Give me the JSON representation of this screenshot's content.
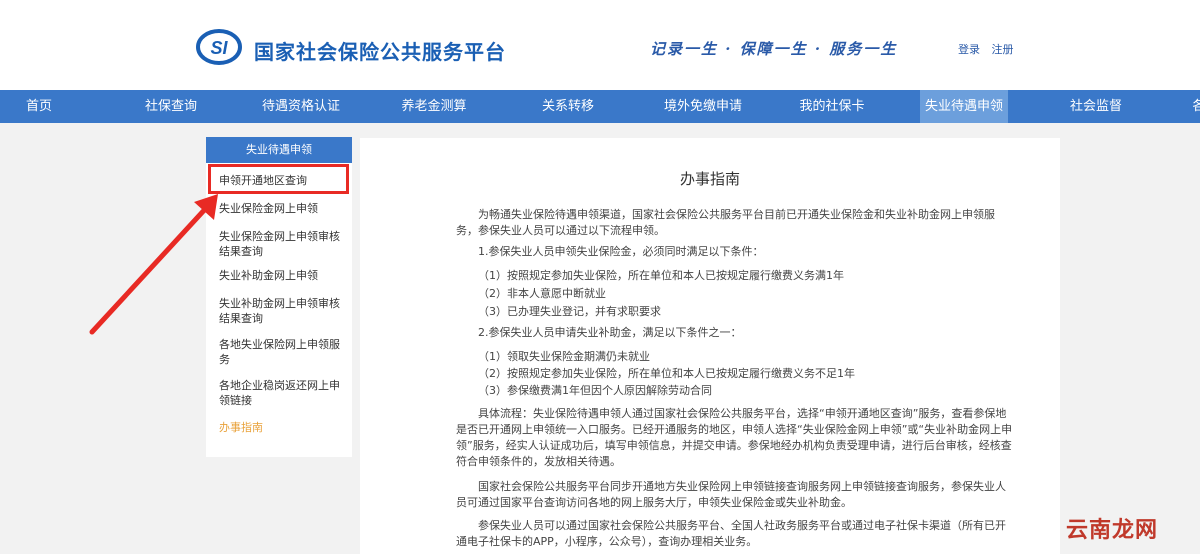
{
  "header": {
    "logo_text": "SI",
    "site_title": "国家社会保险公共服务平台",
    "slogan": "记录一生 · 保障一生 · 服务一生",
    "login_label": "登录",
    "register_label": "注册"
  },
  "nav": {
    "items": [
      {
        "label": "首页"
      },
      {
        "label": "社保查询"
      },
      {
        "label": "待遇资格认证"
      },
      {
        "label": "养老金测算"
      },
      {
        "label": "关系转移"
      },
      {
        "label": "境外免缴申请"
      },
      {
        "label": "我的社保卡"
      },
      {
        "label": "失业待遇申领"
      },
      {
        "label": "社会监督"
      },
      {
        "label": "各"
      }
    ],
    "active_index": 7,
    "colors": {
      "bar": "#3a78c9",
      "active": "#6c9fdc"
    }
  },
  "sidebar": {
    "heading": "失业待遇申领",
    "items": [
      {
        "label": "申领开通地区查询"
      },
      {
        "label": "失业保险金网上申领"
      },
      {
        "label": "失业保险金网上申领审核结果查询"
      },
      {
        "label": "失业补助金网上申领"
      },
      {
        "label": "失业补助金网上申领审核结果查询"
      },
      {
        "label": "各地失业保险网上申领服务"
      },
      {
        "label": "各地企业稳岗返还网上申领链接"
      },
      {
        "label": "办事指南"
      }
    ],
    "highlight_color": "#e9a23b",
    "annotation_color": "#e82a24"
  },
  "main": {
    "title": "办事指南",
    "paragraphs": [
      "为畅通失业保险待遇申领渠道，国家社会保险公共服务平台目前已开通失业保险金和失业补助金网上申领服务，参保失业人员可以通过以下流程申领。",
      "1.参保失业人员申领失业保险金，必须同时满足以下条件：",
      "（1）按照规定参加失业保险，所在单位和本人已按规定履行缴费义务满1年",
      "（2）非本人意愿中断就业",
      "（3）已办理失业登记，并有求职要求",
      "2.参保失业人员申请失业补助金，满足以下条件之一：",
      "（1）领取失业保险金期满仍未就业",
      "（2）按照规定参加失业保险，所在单位和本人已按规定履行缴费义务不足1年",
      "（3）参保缴费满1年但因个人原因解除劳动合同",
      "具体流程：失业保险待遇申领人通过国家社会保险公共服务平台，选择“申领开通地区查询”服务，查看参保地是否已开通网上申领统一入口服务。已经开通服务的地区，申领人选择“失业保险金网上申领”或“失业补助金网上申领”服务，经实人认证成功后，填写申领信息，并提交申请。参保地经办机构负责受理申请，进行后台审核，经核查符合申领条件的，发放相关待遇。",
      "国家社会保险公共服务平台同步开通地方失业保险网上申领链接查询服务网上申领链接查询服务，参保失业人员可通过国家平台查询访问各地的网上服务大厅，申领失业保险金或失业补助金。",
      "参保失业人员可以通过国家社会保险公共服务平台、全国人社政务服务平台或通过电子社保卡渠道（所有已开通电子社保卡的APP，小程序，公众号），查询办理相关业务。"
    ]
  },
  "watermark": "云南龙网"
}
